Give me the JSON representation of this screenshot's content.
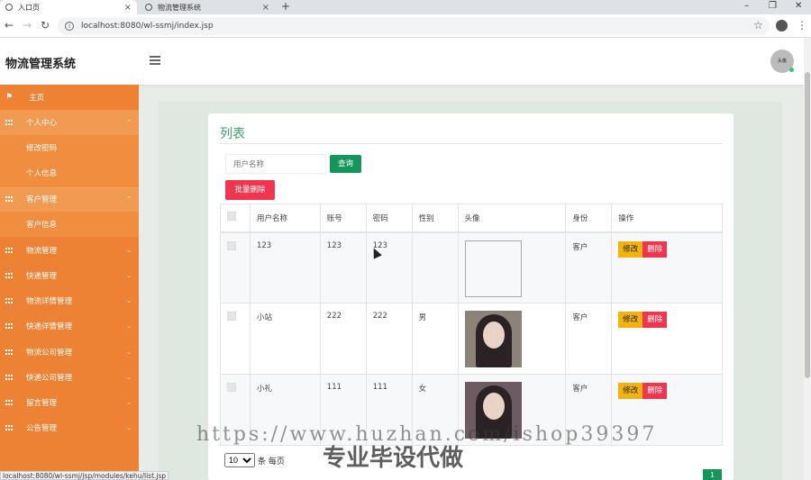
{
  "browser": {
    "tabs": [
      {
        "title": "入口页",
        "active": true
      },
      {
        "title": "物流管理系统",
        "active": false
      }
    ],
    "url": "localhost:8080/wl-ssmj/index.jsp",
    "status_url": "localhost:8080/wl-ssmj/jsp/modules/kehu/list.jsp"
  },
  "header": {
    "app_title": "物流管理系统",
    "avatar_label": "头像"
  },
  "sidebar": {
    "items": [
      {
        "label": "主页",
        "icon": "flag-icon"
      },
      {
        "label": "个人中心",
        "icon": "grid-icon",
        "open": true
      },
      {
        "label": "修改密码",
        "sub": true
      },
      {
        "label": "个人信息",
        "sub": true
      },
      {
        "label": "客户管理",
        "icon": "grid-icon",
        "open": true
      },
      {
        "label": "客户信息",
        "sub": true
      },
      {
        "label": "物流管理",
        "icon": "grid-icon"
      },
      {
        "label": "快递管理",
        "icon": "grid-icon"
      },
      {
        "label": "物流详情管理",
        "icon": "grid-icon"
      },
      {
        "label": "快递详情管理",
        "icon": "grid-icon"
      },
      {
        "label": "物流公司管理",
        "icon": "grid-icon"
      },
      {
        "label": "快递公司管理",
        "icon": "grid-icon"
      },
      {
        "label": "留言管理",
        "icon": "grid-icon"
      },
      {
        "label": "公告管理",
        "icon": "grid-icon"
      }
    ]
  },
  "main": {
    "title": "列表",
    "search_placeholder": "用户名称",
    "search_button": "查询",
    "batch_delete_button": "批量删除",
    "columns": [
      "用户名称",
      "账号",
      "密码",
      "性别",
      "头像",
      "身份",
      "操作"
    ],
    "rows": [
      {
        "name": "123",
        "account": "123",
        "password": "123",
        "gender": "",
        "avatar": "broken",
        "role": "客户"
      },
      {
        "name": "小站",
        "account": "222",
        "password": "222",
        "gender": "男",
        "avatar": "photo",
        "role": "客户"
      },
      {
        "name": "小礼",
        "account": "111",
        "password": "111",
        "gender": "女",
        "avatar": "photo",
        "role": "客户"
      }
    ],
    "edit_label": "修改",
    "delete_label": "删除",
    "page_size": "10",
    "page_size_suffix": "条 每页",
    "current_page": "1"
  },
  "watermark": {
    "url_text": "https://www.huzhan.com/ishop39397",
    "caption": "专业毕设代做"
  },
  "colors": {
    "sidebar": "#ee8234",
    "accent_green": "#14955a",
    "danger": "#f0354f",
    "warning": "#f2b30f"
  }
}
